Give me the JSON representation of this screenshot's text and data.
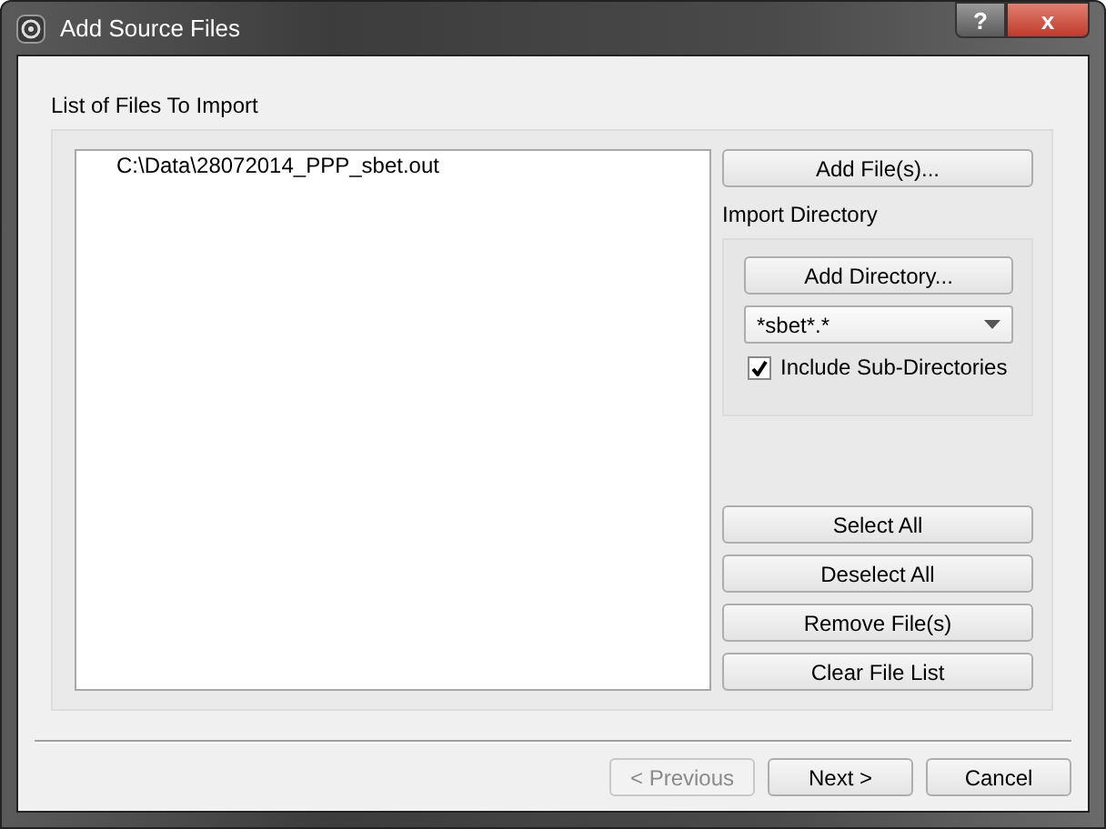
{
  "window": {
    "title": "Add Source Files",
    "title_buttons": [
      {
        "kind": "help",
        "label": "?"
      },
      {
        "kind": "close",
        "label": "x"
      }
    ]
  },
  "files_label": "List of Files To Import",
  "files": [
    "C:\\Data\\28072014_PPP_sbet.out"
  ],
  "add_files_button": "Add File(s)...",
  "import_directory": {
    "label": "Import Directory",
    "add_button": "Add Directory...",
    "filter": "*sbet*.*",
    "include_subdirs": {
      "label": "Include Sub-Directories",
      "checked": true
    }
  },
  "list_buttons": [
    "Select All",
    "Deselect All",
    "Remove File(s)",
    "Clear File List"
  ],
  "footer_buttons": [
    {
      "label": "< Previous",
      "disabled": true
    },
    {
      "label": "Next >",
      "disabled": false
    },
    {
      "label": "Cancel",
      "disabled": false
    }
  ]
}
